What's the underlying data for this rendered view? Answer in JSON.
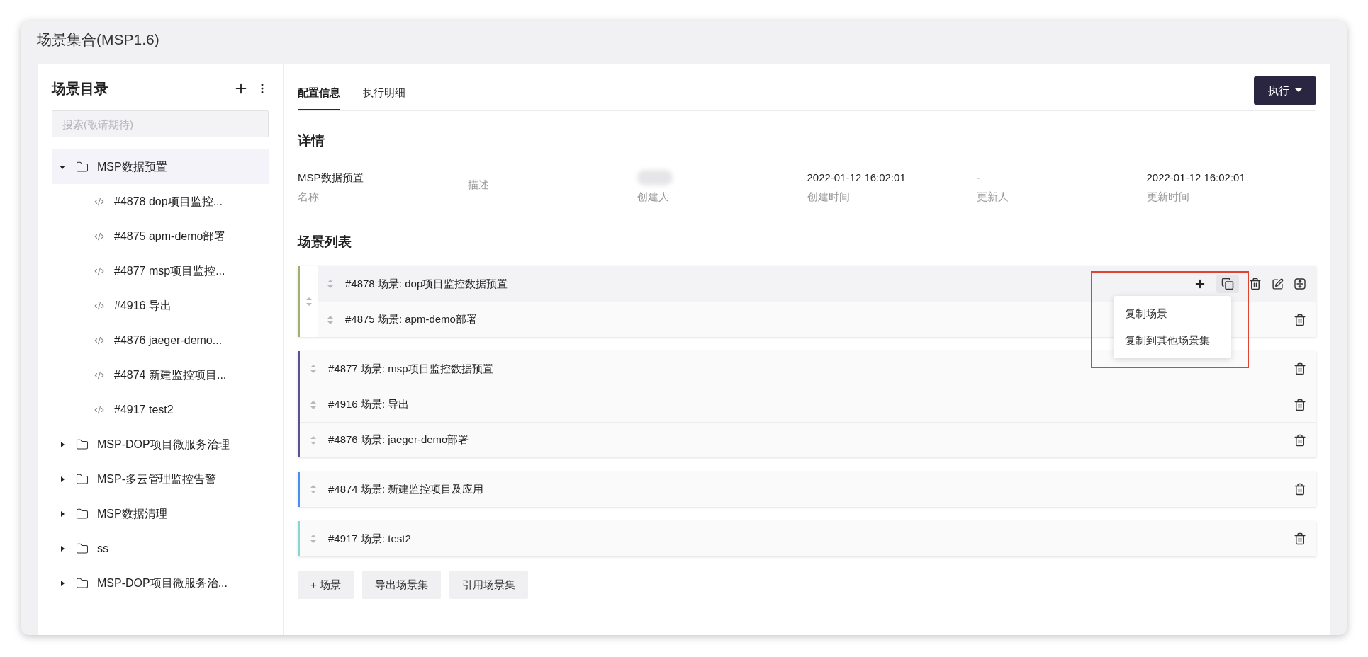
{
  "window": {
    "title": "场景集合(MSP1.6)"
  },
  "sidebar": {
    "title": "场景目录",
    "search": {
      "placeholder": "搜索(敬请期待)"
    },
    "tree": [
      {
        "label": "MSP数据预置",
        "expanded": true,
        "selected": true,
        "children": [
          {
            "label": "#4878 dop项目监控..."
          },
          {
            "label": "#4875 apm-demo部署"
          },
          {
            "label": "#4877 msp项目监控..."
          },
          {
            "label": "#4916 导出"
          },
          {
            "label": "#4876 jaeger-demo..."
          },
          {
            "label": "#4874 新建监控项目..."
          },
          {
            "label": "#4917 test2"
          }
        ]
      },
      {
        "label": "MSP-DOP项目微服务治理",
        "expanded": false,
        "selected": false
      },
      {
        "label": "MSP-多云管理监控告警",
        "expanded": false,
        "selected": false
      },
      {
        "label": "MSP数据清理",
        "expanded": false,
        "selected": false
      },
      {
        "label": "ss",
        "expanded": false,
        "selected": false
      },
      {
        "label": "MSP-DOP项目微服务治...",
        "expanded": false,
        "selected": false
      }
    ]
  },
  "tabs": [
    {
      "label": "配置信息",
      "selected": true
    },
    {
      "label": "执行明细",
      "selected": false
    }
  ],
  "run_button": {
    "label": "执行"
  },
  "details": {
    "title": "详情",
    "fields": [
      {
        "kind": "text",
        "value": "MSP数据预置",
        "label": "名称"
      },
      {
        "kind": "empty",
        "label": "描述"
      },
      {
        "kind": "redacted",
        "label": "创建人"
      },
      {
        "kind": "text",
        "value": "2022-01-12 16:02:01",
        "label": "创建时间"
      },
      {
        "kind": "text",
        "value": "-",
        "label": "更新人"
      },
      {
        "kind": "text",
        "value": "2022-01-12 16:02:01",
        "label": "更新时间"
      }
    ]
  },
  "scene_list": {
    "title": "场景列表",
    "groups": [
      {
        "kind": "nested",
        "color": "#9fb071",
        "scenes": [
          {
            "label": "#4878 场景: dop项目监控数据预置",
            "highlighted": true,
            "menu": [
              "复制场景",
              "复制到其他场景集"
            ]
          },
          {
            "label": "#4875 场景: apm-demo部署",
            "highlighted": false
          }
        ]
      },
      {
        "kind": "flat",
        "color": "#5e5190",
        "scenes": [
          {
            "label": "#4877 场景: msp项目监控数据预置",
            "highlighted": false
          },
          {
            "label": "#4916 场景: 导出",
            "highlighted": false
          },
          {
            "label": "#4876 场景: jaeger-demo部署",
            "highlighted": false
          }
        ]
      },
      {
        "kind": "flat",
        "color": "#4a8ff0",
        "scenes": [
          {
            "label": "#4874 场景: 新建监控项目及应用",
            "highlighted": false
          }
        ]
      },
      {
        "kind": "flat",
        "color": "#86d6d2",
        "scenes": [
          {
            "label": "#4917 场景: test2",
            "highlighted": false
          }
        ]
      }
    ]
  },
  "footer_buttons": [
    "+ 场景",
    "导出场景集",
    "引用场景集"
  ]
}
